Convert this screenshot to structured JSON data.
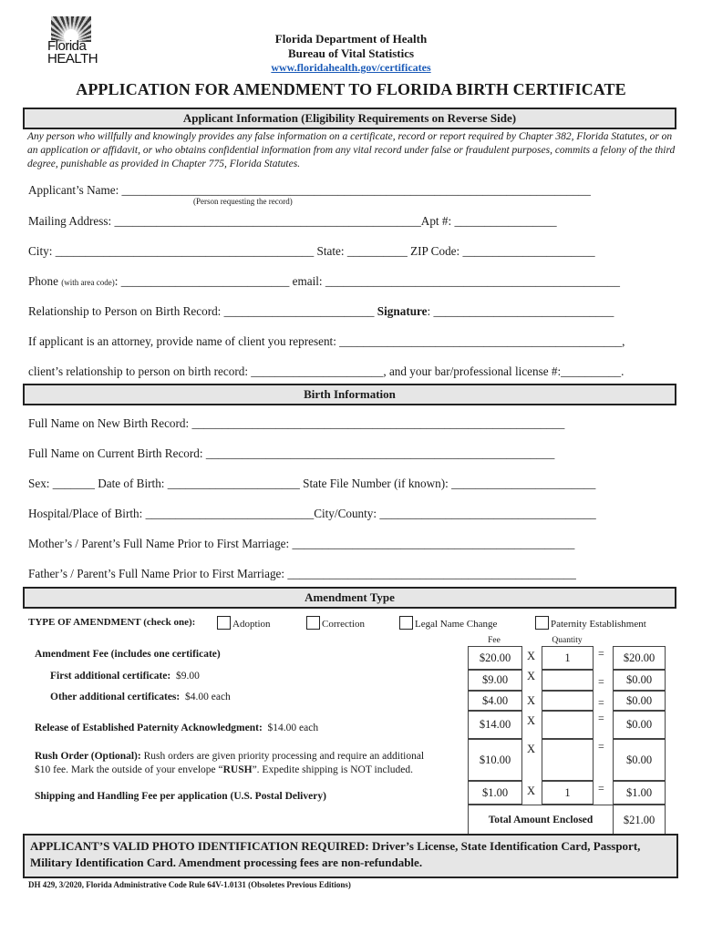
{
  "logo": {
    "icon": "florida-health-sunburst-logo",
    "line1": "Florida",
    "line2": "HEALTH"
  },
  "header": {
    "department": "Florida Department of Health",
    "bureau": "Bureau of Vital Statistics",
    "website": "www.floridahealth.gov/certificates"
  },
  "title": "APPLICATION FOR AMENDMENT TO FLORIDA BIRTH CERTIFICATE",
  "applicant": {
    "section_title": "Applicant Information (Eligibility Requirements on Reverse Side)",
    "warning": "Any person who willfully and knowingly provides any false information on a certificate, record or report required by Chapter 382, Florida Statutes, or on an application or affidavit, or who obtains confidential information from any vital record under false or fraudulent purposes, commits a felony of the third degree, punishable as provided in Chapter 775, Florida Statutes.",
    "name_label": "Applicant’s Name:",
    "name_hint": "(Person requesting the record)",
    "mailing_label": "Mailing Address:",
    "apt_label": "Apt #:",
    "city_label": "City:",
    "state_label": "State:",
    "zip_label": "ZIP Code:",
    "phone_label": "Phone",
    "phone_hint": "(with area code)",
    "email_label": "email:",
    "relationship_label": "Relationship to Person on Birth Record:",
    "signature_label": "Signature",
    "attorney_label": "If applicant is an attorney, provide name of client you represent:",
    "client_rel_label": "client’s relationship to person on birth record:",
    "license_label": ", and your bar/professional license #:"
  },
  "birth": {
    "section_title": "Birth Information",
    "new_name_label": "Full Name on New Birth Record:",
    "current_name_label": "Full Name on Current Birth Record:",
    "sex_label": "Sex:",
    "dob_label": "Date of Birth:",
    "file_number_label": "State File Number (if known):",
    "hospital_label": "Hospital/Place of Birth:",
    "county_label": "City/County:",
    "mother_label": "Mother’s / Parent’s Full Name Prior to First Marriage:",
    "father_label": "Father’s / Parent’s Full Name Prior to First Marriage:"
  },
  "amendment": {
    "section_title": "Amendment Type",
    "type_label": "TYPE OF AMENDMENT (check one):",
    "options": [
      {
        "label": "Adoption",
        "checked": false
      },
      {
        "label": "Correction",
        "checked": false
      },
      {
        "label": "Legal Name Change",
        "checked": false
      },
      {
        "label": "Paternity Establishment",
        "checked": false
      }
    ]
  },
  "fees": {
    "fee_header": "Fee",
    "qty_header": "Quantity",
    "multiply": "X",
    "equals": "=",
    "amendment_fee": "Amendment Fee (includes one certificate)",
    "first_add_label": "First additional certificate:",
    "first_add_value": "$9.00",
    "other_add_label": "Other additional certificates:",
    "other_add_value": "$4.00 each",
    "paternity_label": "Release of Established Paternity Acknowledgment:",
    "paternity_value": "$14.00 each",
    "rush_label": "Rush Order (Optional):",
    "rush_text1": "Rush orders are given priority processing and require an additional",
    "rush_text2a": "$10 fee.  Mark the outside of your envelope “",
    "rush_text2b": "RUSH",
    "rush_text2c": "”. Expedite shipping is NOT included.",
    "shipping_label": "Shipping and Handling Fee per application (U.S. Postal Delivery)",
    "rows": [
      {
        "fee": "$20.00",
        "qty": "1",
        "total": "$20.00"
      },
      {
        "fee": "$9.00",
        "qty": "",
        "total": "$0.00"
      },
      {
        "fee": "$4.00",
        "qty": "",
        "total": "$0.00"
      },
      {
        "fee": "$14.00",
        "qty": "",
        "total": "$0.00"
      },
      {
        "fee": "$10.00",
        "qty": "",
        "total": "$0.00"
      },
      {
        "fee": "$1.00",
        "qty": "1",
        "total": "$1.00"
      }
    ],
    "total_label": "Total Amount Enclosed",
    "total_value": "$21.00"
  },
  "photo_notice": "APPLICANT’S VALID PHOTO IDENTIFICATION REQUIRED: Driver’s License, State Identification Card, Passport, Military Identification Card. Amendment processing fees are non-refundable.",
  "footer": "DH 429, 3/2020, Florida Administrative Code Rule 64V-1.0131 (Obsoletes Previous Editions)"
}
